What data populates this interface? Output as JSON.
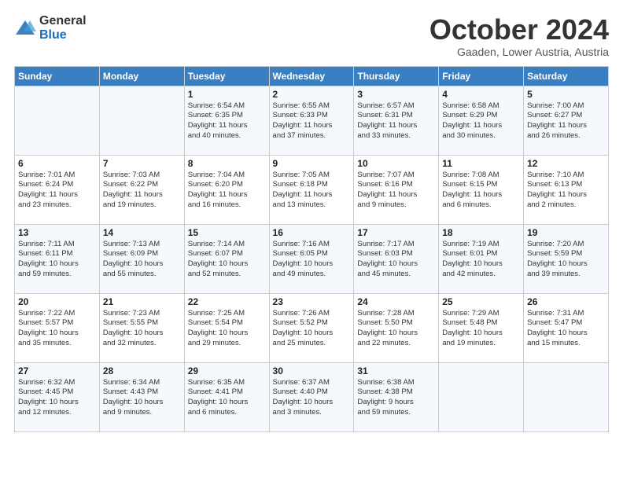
{
  "logo": {
    "general": "General",
    "blue": "Blue"
  },
  "title": "October 2024",
  "location": "Gaaden, Lower Austria, Austria",
  "days_of_week": [
    "Sunday",
    "Monday",
    "Tuesday",
    "Wednesday",
    "Thursday",
    "Friday",
    "Saturday"
  ],
  "weeks": [
    [
      {
        "day": "",
        "info": ""
      },
      {
        "day": "",
        "info": ""
      },
      {
        "day": "1",
        "info": "Sunrise: 6:54 AM\nSunset: 6:35 PM\nDaylight: 11 hours\nand 40 minutes."
      },
      {
        "day": "2",
        "info": "Sunrise: 6:55 AM\nSunset: 6:33 PM\nDaylight: 11 hours\nand 37 minutes."
      },
      {
        "day": "3",
        "info": "Sunrise: 6:57 AM\nSunset: 6:31 PM\nDaylight: 11 hours\nand 33 minutes."
      },
      {
        "day": "4",
        "info": "Sunrise: 6:58 AM\nSunset: 6:29 PM\nDaylight: 11 hours\nand 30 minutes."
      },
      {
        "day": "5",
        "info": "Sunrise: 7:00 AM\nSunset: 6:27 PM\nDaylight: 11 hours\nand 26 minutes."
      }
    ],
    [
      {
        "day": "6",
        "info": "Sunrise: 7:01 AM\nSunset: 6:24 PM\nDaylight: 11 hours\nand 23 minutes."
      },
      {
        "day": "7",
        "info": "Sunrise: 7:03 AM\nSunset: 6:22 PM\nDaylight: 11 hours\nand 19 minutes."
      },
      {
        "day": "8",
        "info": "Sunrise: 7:04 AM\nSunset: 6:20 PM\nDaylight: 11 hours\nand 16 minutes."
      },
      {
        "day": "9",
        "info": "Sunrise: 7:05 AM\nSunset: 6:18 PM\nDaylight: 11 hours\nand 13 minutes."
      },
      {
        "day": "10",
        "info": "Sunrise: 7:07 AM\nSunset: 6:16 PM\nDaylight: 11 hours\nand 9 minutes."
      },
      {
        "day": "11",
        "info": "Sunrise: 7:08 AM\nSunset: 6:15 PM\nDaylight: 11 hours\nand 6 minutes."
      },
      {
        "day": "12",
        "info": "Sunrise: 7:10 AM\nSunset: 6:13 PM\nDaylight: 11 hours\nand 2 minutes."
      }
    ],
    [
      {
        "day": "13",
        "info": "Sunrise: 7:11 AM\nSunset: 6:11 PM\nDaylight: 10 hours\nand 59 minutes."
      },
      {
        "day": "14",
        "info": "Sunrise: 7:13 AM\nSunset: 6:09 PM\nDaylight: 10 hours\nand 55 minutes."
      },
      {
        "day": "15",
        "info": "Sunrise: 7:14 AM\nSunset: 6:07 PM\nDaylight: 10 hours\nand 52 minutes."
      },
      {
        "day": "16",
        "info": "Sunrise: 7:16 AM\nSunset: 6:05 PM\nDaylight: 10 hours\nand 49 minutes."
      },
      {
        "day": "17",
        "info": "Sunrise: 7:17 AM\nSunset: 6:03 PM\nDaylight: 10 hours\nand 45 minutes."
      },
      {
        "day": "18",
        "info": "Sunrise: 7:19 AM\nSunset: 6:01 PM\nDaylight: 10 hours\nand 42 minutes."
      },
      {
        "day": "19",
        "info": "Sunrise: 7:20 AM\nSunset: 5:59 PM\nDaylight: 10 hours\nand 39 minutes."
      }
    ],
    [
      {
        "day": "20",
        "info": "Sunrise: 7:22 AM\nSunset: 5:57 PM\nDaylight: 10 hours\nand 35 minutes."
      },
      {
        "day": "21",
        "info": "Sunrise: 7:23 AM\nSunset: 5:55 PM\nDaylight: 10 hours\nand 32 minutes."
      },
      {
        "day": "22",
        "info": "Sunrise: 7:25 AM\nSunset: 5:54 PM\nDaylight: 10 hours\nand 29 minutes."
      },
      {
        "day": "23",
        "info": "Sunrise: 7:26 AM\nSunset: 5:52 PM\nDaylight: 10 hours\nand 25 minutes."
      },
      {
        "day": "24",
        "info": "Sunrise: 7:28 AM\nSunset: 5:50 PM\nDaylight: 10 hours\nand 22 minutes."
      },
      {
        "day": "25",
        "info": "Sunrise: 7:29 AM\nSunset: 5:48 PM\nDaylight: 10 hours\nand 19 minutes."
      },
      {
        "day": "26",
        "info": "Sunrise: 7:31 AM\nSunset: 5:47 PM\nDaylight: 10 hours\nand 15 minutes."
      }
    ],
    [
      {
        "day": "27",
        "info": "Sunrise: 6:32 AM\nSunset: 4:45 PM\nDaylight: 10 hours\nand 12 minutes."
      },
      {
        "day": "28",
        "info": "Sunrise: 6:34 AM\nSunset: 4:43 PM\nDaylight: 10 hours\nand 9 minutes."
      },
      {
        "day": "29",
        "info": "Sunrise: 6:35 AM\nSunset: 4:41 PM\nDaylight: 10 hours\nand 6 minutes."
      },
      {
        "day": "30",
        "info": "Sunrise: 6:37 AM\nSunset: 4:40 PM\nDaylight: 10 hours\nand 3 minutes."
      },
      {
        "day": "31",
        "info": "Sunrise: 6:38 AM\nSunset: 4:38 PM\nDaylight: 9 hours\nand 59 minutes."
      },
      {
        "day": "",
        "info": ""
      },
      {
        "day": "",
        "info": ""
      }
    ]
  ]
}
